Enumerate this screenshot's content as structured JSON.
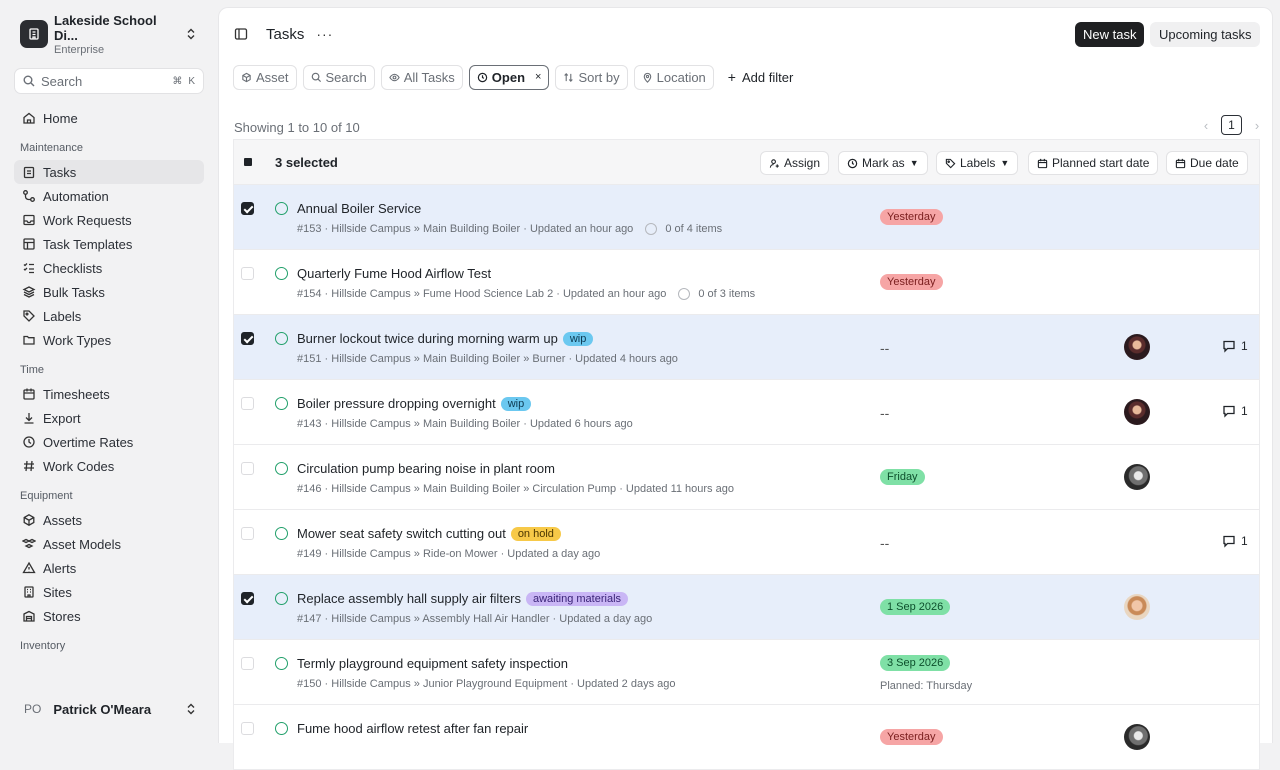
{
  "org": {
    "name": "Lakeside School Di...",
    "plan": "Enterprise"
  },
  "search": {
    "placeholder": "Search",
    "shortcut_mod": "⌘",
    "shortcut_key": "K"
  },
  "nav": {
    "home": "Home",
    "groups": [
      {
        "label": "Maintenance",
        "items": [
          "Tasks",
          "Automation",
          "Work Requests",
          "Task Templates",
          "Checklists",
          "Bulk Tasks",
          "Labels",
          "Work Types"
        ]
      },
      {
        "label": "Time",
        "items": [
          "Timesheets",
          "Export",
          "Overtime Rates",
          "Work Codes"
        ]
      },
      {
        "label": "Equipment",
        "items": [
          "Assets",
          "Asset Models",
          "Alerts",
          "Sites",
          "Stores"
        ]
      },
      {
        "label": "Inventory",
        "items": []
      }
    ]
  },
  "user": {
    "initials": "PO",
    "name": "Patrick O'Meara"
  },
  "header": {
    "title": "Tasks",
    "more": "···",
    "new_task": "New task",
    "upcoming": "Upcoming tasks"
  },
  "filters": {
    "asset": "Asset",
    "search": "Search",
    "all_tasks": "All Tasks",
    "open": "Open",
    "open_close": "×",
    "sort_by": "Sort by",
    "location": "Location",
    "add_filter": "Add filter"
  },
  "list": {
    "showing": "Showing 1 to 10 of 10",
    "page": "1",
    "prev": "‹",
    "next": "›"
  },
  "bulk": {
    "selected": "3 selected",
    "assign": "Assign",
    "mark_as": "Mark as",
    "labels": "Labels",
    "planned_start": "Planned start date",
    "due_date": "Due date"
  },
  "tasks": [
    {
      "title": "Annual Boiler Service",
      "meta": "#153 · Hillside Campus » Main Building Boiler · Updated an hour ago",
      "items": "0 of 4 items",
      "due": "Yesterday",
      "due_color": "red",
      "selected": true
    },
    {
      "title": "Quarterly Fume Hood Airflow Test",
      "meta": "#154 · Hillside Campus » Fume Hood Science Lab 2 · Updated an hour ago",
      "items": "0 of 3 items",
      "due": "Yesterday",
      "due_color": "red",
      "selected": false
    },
    {
      "title": "Burner lockout twice during morning warm up",
      "tag": "wip",
      "meta": "#151 · Hillside Campus » Main Building Boiler » Burner · Updated 4 hours ago",
      "due": "--",
      "avatar": "a1",
      "comments": "1",
      "selected": true
    },
    {
      "title": "Boiler pressure dropping overnight",
      "tag": "wip",
      "meta": "#143 · Hillside Campus » Main Building Boiler · Updated 6 hours ago",
      "due": "--",
      "avatar": "a1",
      "comments": "1",
      "selected": false
    },
    {
      "title": "Circulation pump bearing noise in plant room",
      "meta": "#146 · Hillside Campus » Main Building Boiler » Circulation Pump · Updated 11 hours ago",
      "due": "Friday",
      "due_color": "green",
      "avatar": "a2",
      "selected": false
    },
    {
      "title": "Mower seat safety switch cutting out",
      "tag": "on hold",
      "meta": "#149 · Hillside Campus » Ride-on Mower · Updated a day ago",
      "due": "--",
      "comments": "1",
      "selected": false
    },
    {
      "title": "Replace assembly hall supply air filters",
      "tag": "awaiting materials",
      "meta": "#147 · Hillside Campus » Assembly Hall Air Handler · Updated a day ago",
      "due": "1 Sep 2026",
      "due_color": "green",
      "avatar": "a3",
      "selected": true
    },
    {
      "title": "Termly playground equipment safety inspection",
      "meta": "#150 · Hillside Campus » Junior Playground Equipment · Updated 2 days ago",
      "due": "3 Sep 2026",
      "due_color": "green",
      "planned": "Planned: Thursday",
      "selected": false
    },
    {
      "title": "Fume hood airflow retest after fan repair",
      "meta": "",
      "due": "Yesterday",
      "due_color": "red",
      "avatar": "a2",
      "selected": false
    }
  ]
}
